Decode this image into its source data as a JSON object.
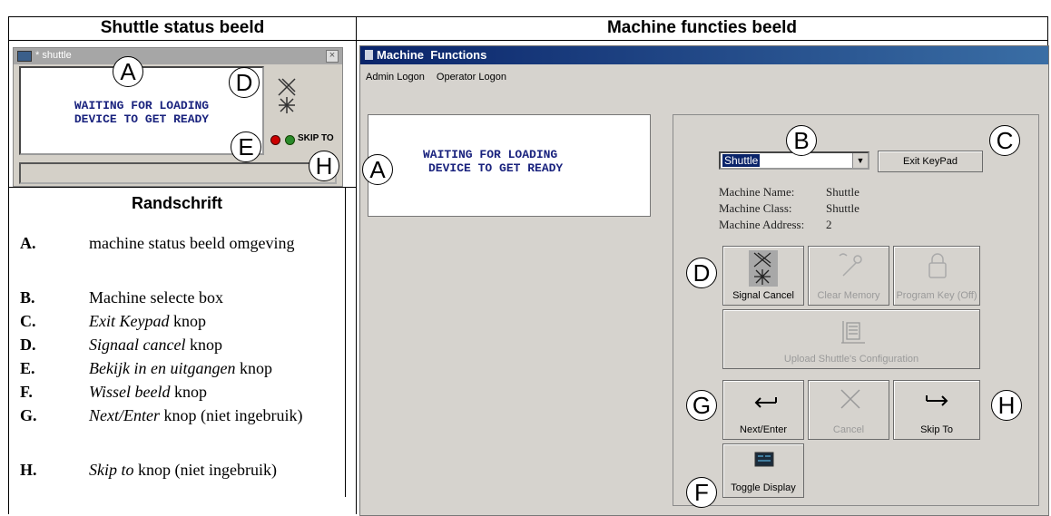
{
  "headers": {
    "left": "Shuttle status beeld",
    "right": "Machine functies beeld",
    "legend": "Randschrift"
  },
  "shuttle_window": {
    "title": "* shuttle",
    "status_text_line1": "WAITING FOR LOADING",
    "status_text_line2": "DEVICE TO GET READY",
    "skip_label": "SKIP TO"
  },
  "machine_window": {
    "title": "Machine  Functions",
    "menu": [
      "Admin Logon",
      "Operator Logon"
    ],
    "status_text_line1": "WAITING FOR LOADING",
    "status_text_line2": "DEVICE TO GET READY",
    "machine_select_value": "Shuttle",
    "exit_keypad_label": "Exit KeyPad",
    "info": [
      {
        "label": "Machine Name:",
        "value": "Shuttle"
      },
      {
        "label": "Machine Class:",
        "value": "Shuttle"
      },
      {
        "label": "Machine Address:",
        "value": "2"
      }
    ],
    "buttons": {
      "signal_cancel": "Signal Cancel",
      "clear_memory": "Clear Memory",
      "program_key": "Program Key (Off)",
      "upload_config": "Upload Shuttle's Configuration",
      "next_enter": "Next/Enter",
      "cancel": "Cancel",
      "skip_to": "Skip To",
      "toggle_display": "Toggle Display"
    }
  },
  "callouts": {
    "A": "A",
    "B": "B",
    "C": "C",
    "D": "D",
    "E": "E",
    "F": "F",
    "G": "G",
    "H": "H"
  },
  "legend": [
    {
      "key": "A.",
      "text": "machine status beeld omgeving"
    },
    {
      "key": "B.",
      "text": "Machine selecte box"
    },
    {
      "key": "C.",
      "text_italic": "Exit Keypad",
      "text": " knop"
    },
    {
      "key": "D.",
      "text_italic": "Signaal cancel",
      "text": " knop"
    },
    {
      "key": "E.",
      "text_italic": "Bekijk in en uitgangen",
      "text": " knop"
    },
    {
      "key": "F.",
      "text_italic": "Wissel beeld",
      "text": " knop"
    },
    {
      "key": "G.",
      "text_italic": "Next/Enter",
      "text": " knop (niet ingebruik)"
    },
    {
      "key": "H.",
      "text_italic": "Skip to",
      "text": " knop (niet ingebruik)"
    }
  ]
}
